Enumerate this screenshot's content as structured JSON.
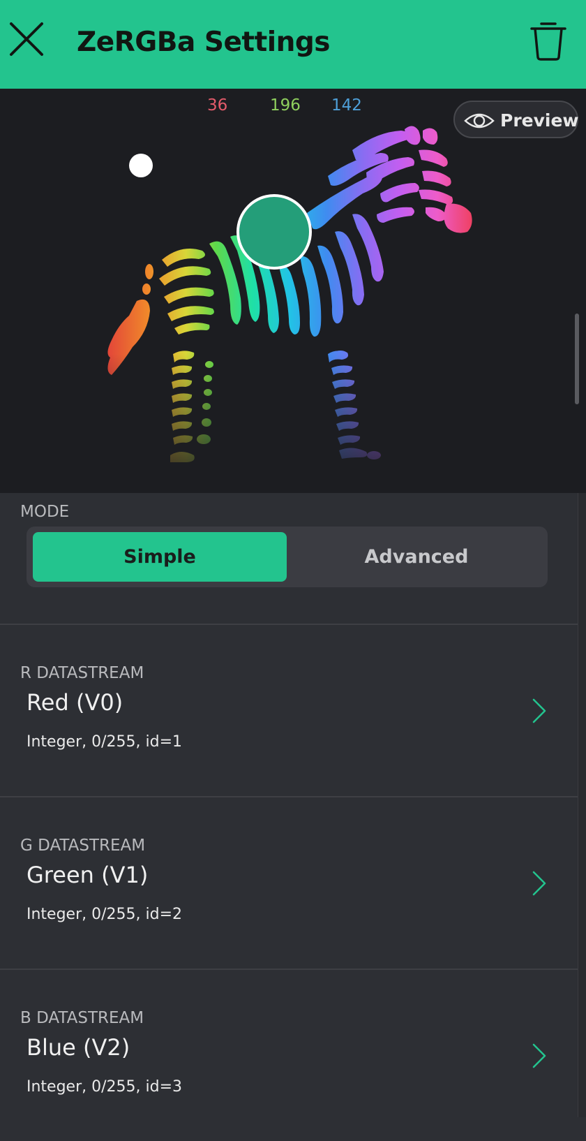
{
  "header": {
    "title": "ZeRGBa Settings",
    "close_icon": "close-icon",
    "delete_icon": "trash-icon"
  },
  "preview": {
    "rgb": {
      "r": "36",
      "g": "196",
      "b": "142"
    },
    "preview_label": "Preview",
    "preview_icon": "eye-icon",
    "picker_color": "#249e79"
  },
  "mode": {
    "label": "MODE",
    "options": [
      "Simple",
      "Advanced"
    ],
    "selected": "Simple"
  },
  "datastreams": [
    {
      "caption": "R DATASTREAM",
      "name": "Red (V0)",
      "meta": "Integer, 0/255, id=1"
    },
    {
      "caption": "G DATASTREAM",
      "name": "Green (V1)",
      "meta": "Integer, 0/255, id=2"
    },
    {
      "caption": "B DATASTREAM",
      "name": "Blue (V2)",
      "meta": "Integer, 0/255, id=3"
    }
  ],
  "colors": {
    "accent": "#23c48e",
    "background": "#2d2f34",
    "preview_bg": "#1c1d21"
  }
}
